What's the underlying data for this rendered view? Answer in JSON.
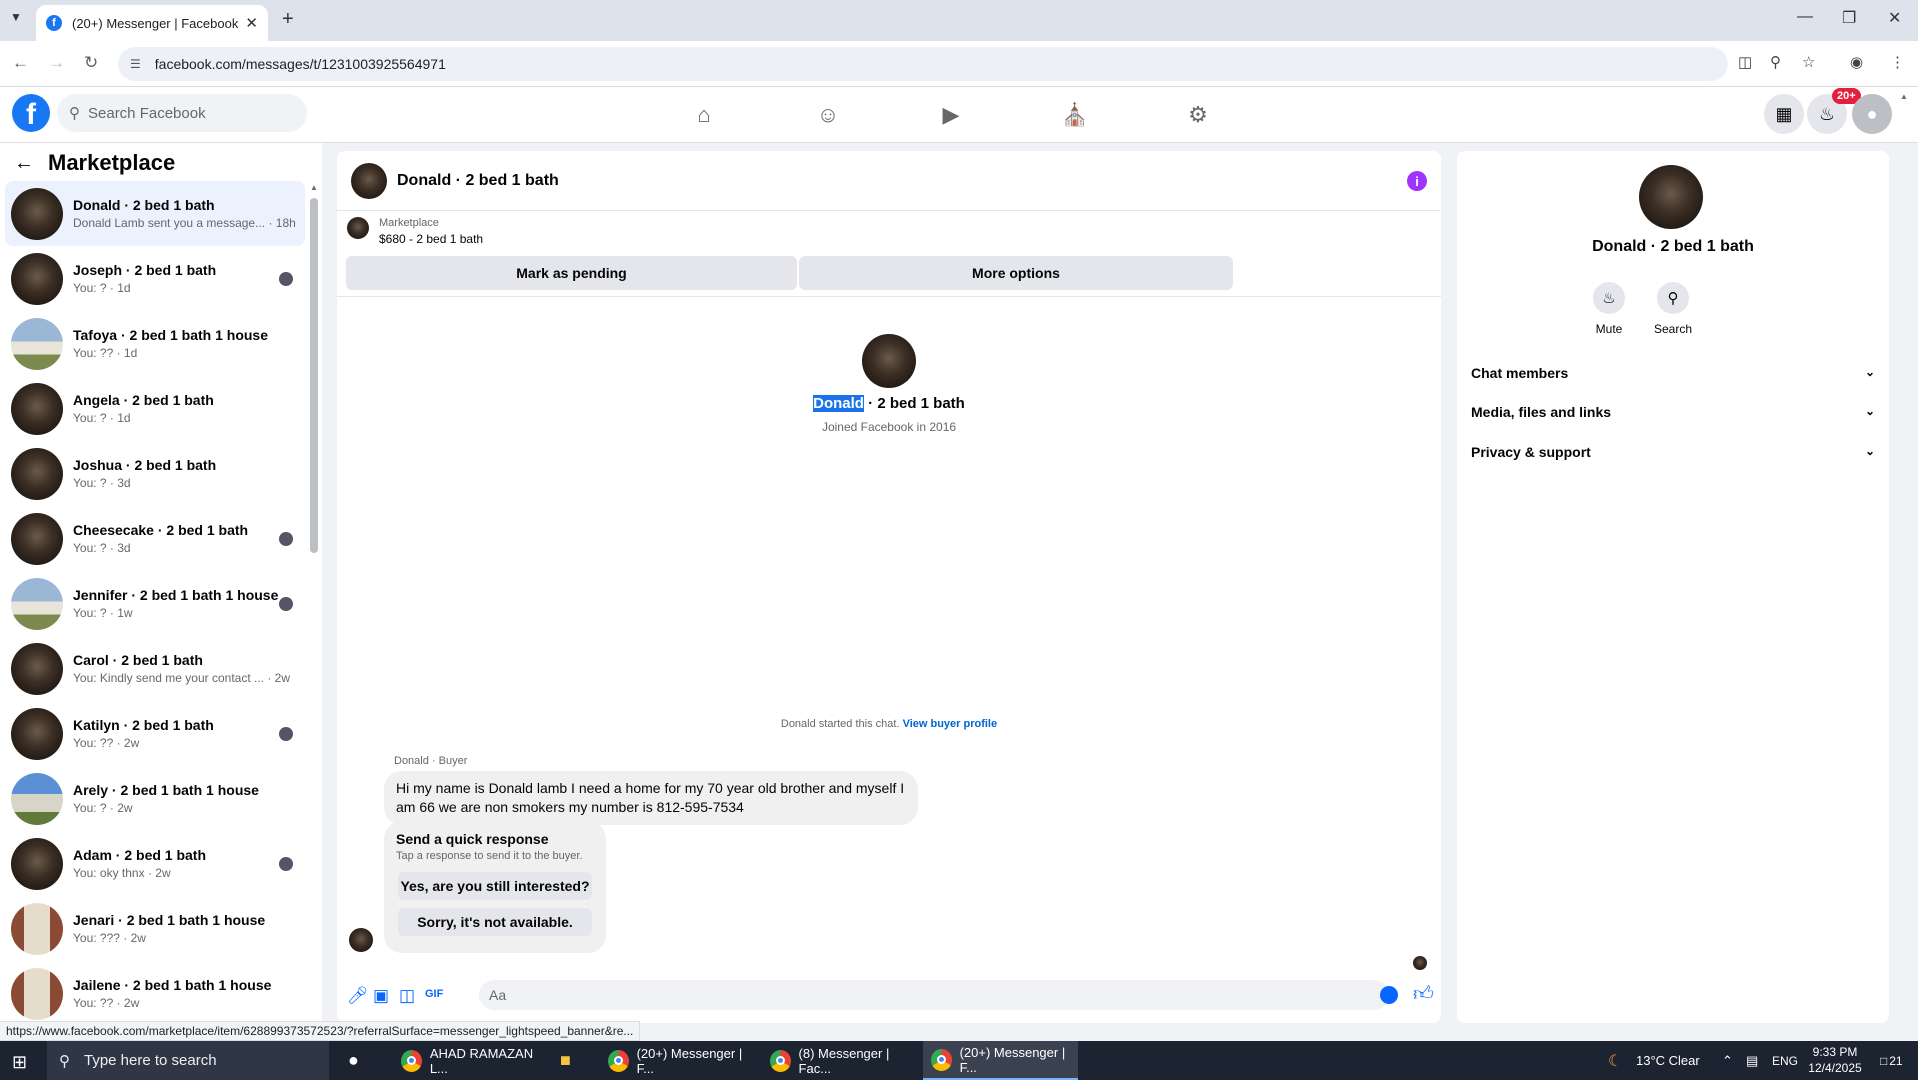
{
  "browser": {
    "tab_title": "(20+) Messenger | Facebook",
    "url": "facebook.com/messages/t/1231003925564971",
    "status_url": "https://www.facebook.com/marketplace/item/628899373572523/?referralSurface=messenger_lightspeed_banner&re..."
  },
  "fb": {
    "search_placeholder": "Search Facebook",
    "notif_badge": "20+"
  },
  "left": {
    "title": "Marketplace",
    "conversations": [
      {
        "name": "Donald · 2 bed 1 bath",
        "sub": "Donald Lamb sent you a message... · 18h",
        "avatar": "room",
        "active": true,
        "seen": false
      },
      {
        "name": "Joseph · 2 bed 1 bath",
        "sub": "You: ? · 1d",
        "avatar": "room",
        "active": false,
        "seen": true
      },
      {
        "name": "Tafoya · 2 bed 1 bath 1 house",
        "sub": "You: ?? · 1d",
        "avatar": "house",
        "active": false,
        "seen": false
      },
      {
        "name": "Angela · 2 bed 1 bath",
        "sub": "You: ? · 1d",
        "avatar": "room",
        "active": false,
        "seen": false
      },
      {
        "name": "Joshua · 2 bed 1 bath",
        "sub": "You: ? · 3d",
        "avatar": "room",
        "active": false,
        "seen": false
      },
      {
        "name": "Cheesecake · 2 bed 1 bath",
        "sub": "You: ? · 3d",
        "avatar": "room",
        "active": false,
        "seen": true
      },
      {
        "name": "Jennifer · 2 bed 1 bath 1 house",
        "sub": "You: ? · 1w",
        "avatar": "house",
        "active": false,
        "seen": true
      },
      {
        "name": "Carol · 2 bed 1 bath",
        "sub": "You: Kindly send me your contact ... · 2w",
        "avatar": "room",
        "active": false,
        "seen": false
      },
      {
        "name": "Katilyn · 2 bed 1 bath",
        "sub": "You: ?? · 2w",
        "avatar": "room",
        "active": false,
        "seen": true
      },
      {
        "name": "Arely · 2 bed 1 bath 1 house",
        "sub": "You: ? · 2w",
        "avatar": "blue",
        "active": false,
        "seen": false
      },
      {
        "name": "Adam · 2 bed 1 bath",
        "sub": "You: oky thnx · 2w",
        "avatar": "room",
        "active": false,
        "seen": true
      },
      {
        "name": "Jenari · 2 bed 1 bath 1 house",
        "sub": "You: ??? · 2w",
        "avatar": "brick",
        "active": false,
        "seen": false
      },
      {
        "name": "Jailene · 2 bed 1 bath 1 house",
        "sub": "You: ?? · 2w",
        "avatar": "brick",
        "active": false,
        "seen": false
      }
    ]
  },
  "chat": {
    "title": "Donald · 2 bed 1 bath",
    "listing_label": "Marketplace",
    "listing_value": "$680 - 2 bed 1 bath",
    "mark_pending": "Mark as pending",
    "more_options": "More options",
    "profile_first": "Donald",
    "profile_rest": " · 2 bed 1 bath",
    "joined": "Joined Facebook in 2016",
    "started_text": "Donald started this chat. ",
    "view_buyer": "View buyer profile",
    "sender_label": "Donald · Buyer",
    "message": "Hi my name is Donald lamb I need a home for my 70 year old brother and myself I am 66 we are non smokers my number is 812-595-7534",
    "quick_title": "Send a quick response",
    "quick_sub": "Tap a response to send it to the buyer.",
    "quick_1": "Yes, are you still interested?",
    "quick_2": "Sorry, it's not available.",
    "input_placeholder": "Aa"
  },
  "right": {
    "name": "Donald · 2 bed 1 bath",
    "mute": "Mute",
    "search": "Search",
    "sections": [
      "Chat members",
      "Media, files and links",
      "Privacy & support"
    ]
  },
  "taskbar": {
    "search_placeholder": "Type here to search",
    "apps": [
      "AHAD RAMAZAN L...",
      "(20+) Messenger | F...",
      "(8) Messenger | Fac...",
      "(20+) Messenger | F..."
    ],
    "weather": "13°C  Clear",
    "lang": "ENG",
    "time": "9:33 PM",
    "date": "12/4/2025",
    "notif_count": "21"
  }
}
